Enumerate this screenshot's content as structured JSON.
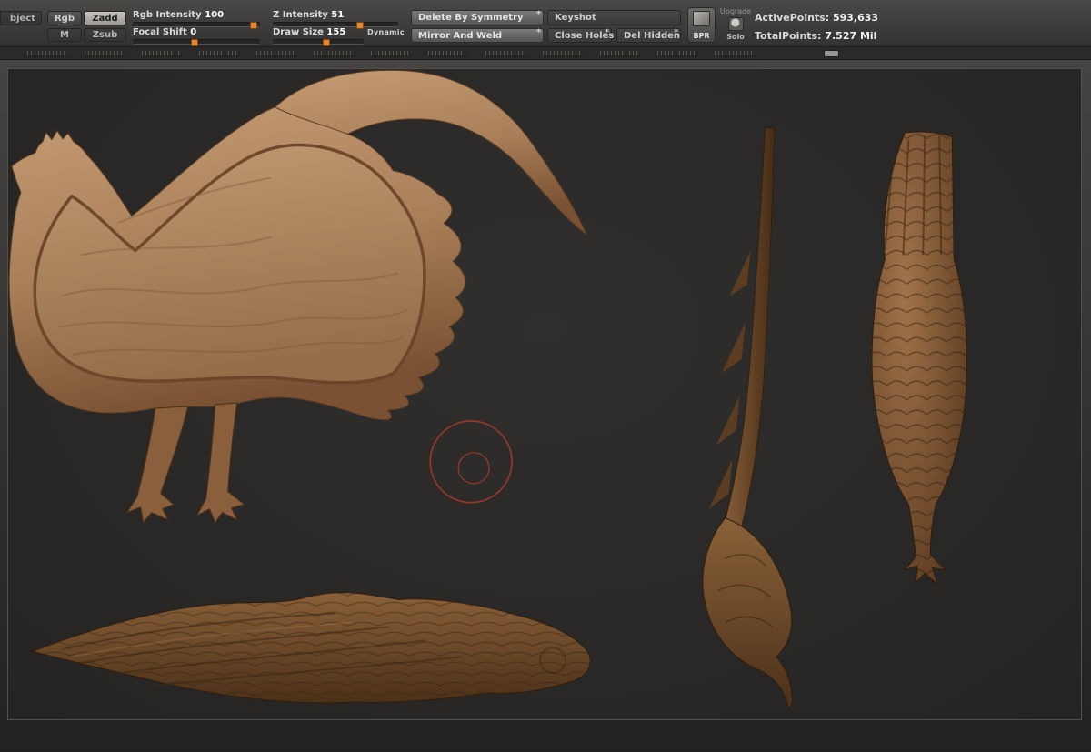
{
  "toolbar": {
    "object": "bject",
    "rgb": "Rgb",
    "zadd": "Zadd",
    "m": "M",
    "zsub": "Zsub",
    "sliders": {
      "rgb_intensity": {
        "label": "Rgb Intensity",
        "value": "100"
      },
      "focal_shift": {
        "label": "Focal Shift",
        "value": "0"
      },
      "z_intensity": {
        "label": "Z Intensity",
        "value": "51"
      },
      "draw_size": {
        "label": "Draw Size",
        "value": "155"
      },
      "dynamic": "Dynamic"
    },
    "buttons": {
      "delete_by_symmetry": "Delete By Symmetry",
      "mirror_and_weld": "Mirror And Weld",
      "keyshot": "Keyshot",
      "close_holes": "Close Holes",
      "del_hidden": "Del Hidden",
      "bpr": "BPR",
      "upgrade": "Upgrade",
      "solo": "Solo",
      "asterisk": "*"
    },
    "stats": {
      "active_points_label": "ActivePoints:",
      "active_points_value": "593,633",
      "total_points_label": "TotalPoints:",
      "total_points_value": "7.527 Mil"
    }
  },
  "colors": {
    "accent_orange": "#e6862e",
    "cursor_red": "#b03a2e",
    "model_tan": "#a87f58",
    "model_brown": "#5d3d22",
    "canvas_bg": "#292826"
  },
  "canvas": {
    "views": {
      "relief": "rooster-relief-side-view",
      "lying": "rooster-top-view",
      "edge": "rooster-edge-profile-view",
      "back": "rooster-back-view"
    }
  }
}
